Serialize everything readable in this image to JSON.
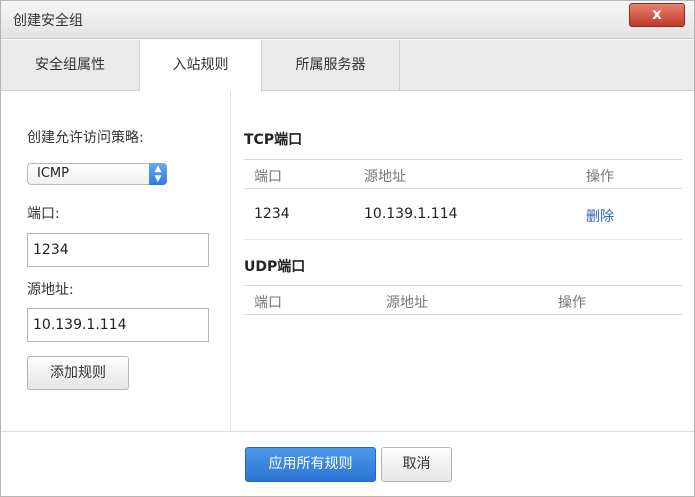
{
  "window": {
    "title": "创建安全组",
    "close_label": "x"
  },
  "tabs": [
    {
      "label": "安全组属性",
      "active": false
    },
    {
      "label": "入站规则",
      "active": true
    },
    {
      "label": "所属服务器",
      "active": false
    }
  ],
  "form": {
    "policy_label": "创建允许访问策略:",
    "protocol_value": "ICMP",
    "port_label": "端口:",
    "port_value": "1234",
    "source_label": "源地址:",
    "source_value": "10.139.1.114",
    "add_button": "添加规则"
  },
  "tcp": {
    "title": "TCP端口",
    "headers": {
      "port": "端口",
      "source": "源地址",
      "action": "操作"
    },
    "rows": [
      {
        "port": "1234",
        "source": "10.139.1.114",
        "action": "删除"
      }
    ]
  },
  "udp": {
    "title": "UDP端口",
    "headers": {
      "port": "端口",
      "source": "源地址",
      "action": "操作"
    }
  },
  "footer": {
    "apply_button": "应用所有规则",
    "cancel_button": "取消"
  },
  "colors": {
    "primary": "#2b74d4",
    "close": "#c0392b",
    "link": "#3461b6"
  }
}
